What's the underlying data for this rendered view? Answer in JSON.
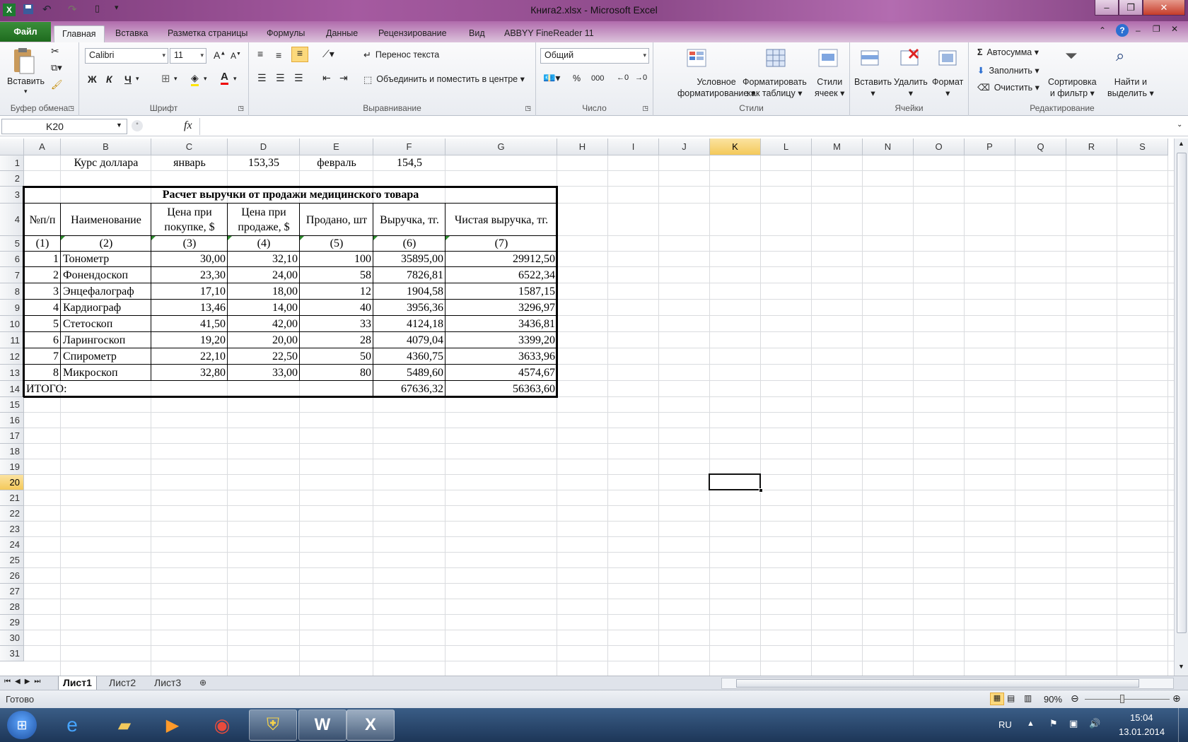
{
  "window": {
    "title": "Книга2.xlsx - Microsoft Excel"
  },
  "ribbon_tabs": [
    "Файл",
    "Главная",
    "Вставка",
    "Разметка страницы",
    "Формулы",
    "Данные",
    "Рецензирование",
    "Вид",
    "ABBYY FineReader 11"
  ],
  "ribbon": {
    "clipboard": {
      "paste": "Вставить",
      "group": "Буфер обмена"
    },
    "font": {
      "name": "Calibri",
      "size": "11",
      "group": "Шрифт",
      "bold": "Ж",
      "italic": "К",
      "underline": "Ч"
    },
    "alignment": {
      "wrap": "Перенос текста",
      "merge": "Объединить и поместить в центре",
      "group": "Выравнивание"
    },
    "number": {
      "format": "Общий",
      "percent": "%",
      "thousands": "000",
      "group": "Число"
    },
    "styles": {
      "cond1": "Условное",
      "cond2": "форматирование",
      "table1": "Форматировать",
      "table2": "как таблицу",
      "cell1": "Стили",
      "cell2": "ячеек",
      "group": "Стили"
    },
    "cells": {
      "insert": "Вставить",
      "delete": "Удалить",
      "format": "Формат",
      "group": "Ячейки"
    },
    "editing": {
      "autosum": "Автосумма",
      "fill": "Заполнить",
      "clear": "Очистить",
      "sort1": "Сортировка",
      "sort2": "и фильтр",
      "find1": "Найти и",
      "find2": "выделить",
      "group": "Редактирование"
    }
  },
  "formula_bar": {
    "name_box": "K20",
    "fx": "fx",
    "formula": ""
  },
  "columns": [
    "A",
    "B",
    "C",
    "D",
    "E",
    "F",
    "G",
    "H",
    "I",
    "J",
    "K",
    "L",
    "M",
    "N",
    "O",
    "P",
    "Q",
    "R",
    "S"
  ],
  "rows": [
    "1",
    "2",
    "3",
    "4",
    "5",
    "6",
    "7",
    "8",
    "9",
    "10",
    "11",
    "12",
    "13",
    "14",
    "15",
    "16",
    "17",
    "18",
    "19",
    "20",
    "21",
    "22",
    "23",
    "24",
    "25",
    "26",
    "27",
    "28",
    "29",
    "30",
    "31"
  ],
  "selected": {
    "column": "K",
    "row": "20"
  },
  "row1": {
    "label": "Курс доллара",
    "m1": "январь",
    "v1": "153,35",
    "m2": "февраль",
    "v2": "154,5"
  },
  "table": {
    "title": "Расчет выручки от продажи медицинского товара",
    "headers": [
      "№п/п",
      "Наименование",
      "Цена при покупке, $",
      "Цена при продаже, $",
      "Продано, шт",
      "Выручка, тг.",
      "Чистая выручка, тг."
    ],
    "indexes": [
      "(1)",
      "(2)",
      "(3)",
      "(4)",
      "(5)",
      "(6)",
      "(7)"
    ],
    "rows": [
      [
        "1",
        "Тонометр",
        "30,00",
        "32,10",
        "100",
        "35895,00",
        "29912,50"
      ],
      [
        "2",
        "Фонендоскоп",
        "23,30",
        "24,00",
        "58",
        "7826,81",
        "6522,34"
      ],
      [
        "3",
        "Энцефалограф",
        "17,10",
        "18,00",
        "12",
        "1904,58",
        "1587,15"
      ],
      [
        "4",
        "Кардиограф",
        "13,46",
        "14,00",
        "40",
        "3956,36",
        "3296,97"
      ],
      [
        "5",
        "Стетоскоп",
        "41,50",
        "42,00",
        "33",
        "4124,18",
        "3436,81"
      ],
      [
        "6",
        "Ларингоскоп",
        "19,20",
        "20,00",
        "28",
        "4079,04",
        "3399,20"
      ],
      [
        "7",
        "Спирометр",
        "22,10",
        "22,50",
        "50",
        "4360,75",
        "3633,96"
      ],
      [
        "8",
        "Микроскоп",
        "32,80",
        "33,00",
        "80",
        "5489,60",
        "4574,67"
      ]
    ],
    "total": {
      "label": "ИТОГО:",
      "revenue": "67636,32",
      "net": "56363,60"
    }
  },
  "sheets": [
    "Лист1",
    "Лист2",
    "Лист3"
  ],
  "status": {
    "ready": "Готово",
    "zoom": "90%"
  },
  "taskbar": {
    "lang": "RU",
    "time": "15:04",
    "date": "13.01.2014"
  }
}
